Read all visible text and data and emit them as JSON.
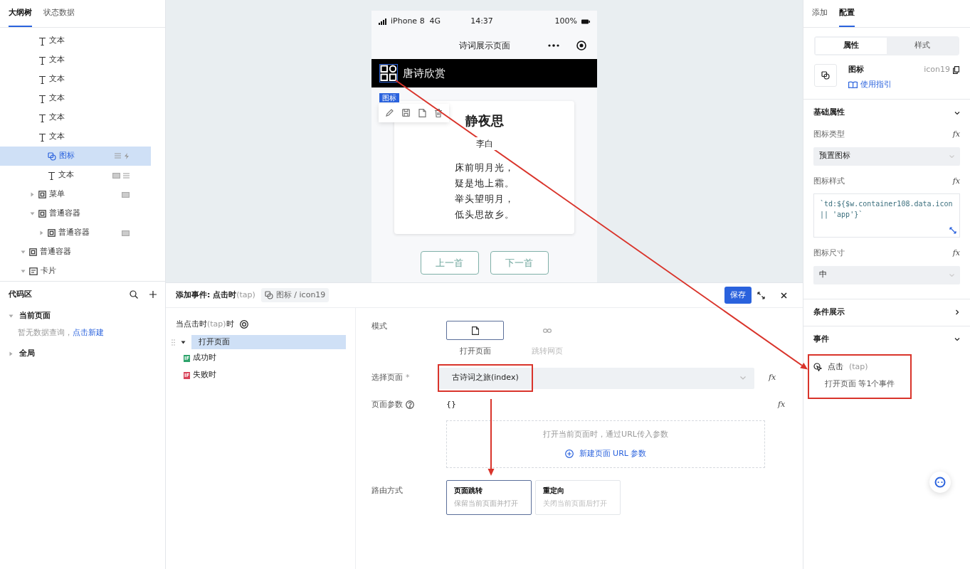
{
  "outline": {
    "tabs": [
      {
        "label": "大纲树",
        "selected": true
      },
      {
        "label": "状态数据",
        "selected": false
      }
    ],
    "nodes": [
      {
        "children": [
          {
            "label": "文本",
            "kind": "text",
            "selected": false
          },
          {
            "label": "文本",
            "kind": "text",
            "selected": false
          },
          {
            "label": "文本",
            "kind": "text",
            "selected": false
          },
          {
            "label": "文本",
            "kind": "text",
            "selected": false
          },
          {
            "label": "文本",
            "kind": "text",
            "selected": false
          },
          {
            "label": "文本",
            "kind": "text",
            "selected": false
          },
          {
            "children": [
              {
                "label": "图标",
                "kind": "icon",
                "selected": true,
                "markers": [
                  {
                    "kind": "list"
                  },
                  {
                    "kind": "event"
                  }
                ]
              },
              {
                "label": "文本",
                "kind": "text",
                "selected": false,
                "markers": [
                  {
                    "kind": "data"
                  },
                  {
                    "kind": "list"
                  }
                ]
              }
            ]
          },
          {
            "label": "菜单",
            "kind": "container",
            "expanded": false,
            "selected": false,
            "markers": [
              {
                "kind": "data"
              }
            ]
          },
          {
            "label": "普通容器",
            "kind": "container",
            "expanded": true,
            "selected": false,
            "children": [
              {
                "label": "普通容器",
                "kind": "container",
                "expanded": false,
                "selected": false,
                "markers": [
                  {
                    "kind": "data"
                  }
                ]
              }
            ]
          }
        ]
      },
      {
        "label": "普通容器",
        "kind": "container",
        "expanded": true,
        "selected": false
      },
      {
        "label": "卡片",
        "kind": "card",
        "expanded": true,
        "selected": false
      }
    ]
  },
  "code_area": {
    "title": "代码区",
    "groups": [
      {
        "label": "当前页面",
        "expanded": true,
        "empty_text": "暂无数据查询，",
        "link": "点击新建"
      },
      {
        "label": "全局",
        "expanded": false
      }
    ]
  },
  "phone": {
    "carrier": "iPhone 8  4G",
    "time": "14:37",
    "battery": "100%",
    "nav_title": "诗词展示页面",
    "header_title": "唐诗欣赏",
    "selection_tag": "图标",
    "poem": {
      "title": "静夜思",
      "author": "李白",
      "lines": [
        "床前明月光，",
        "疑是地上霜。",
        "举头望明月，",
        "低头思故乡。"
      ]
    },
    "buttons": [
      "上一首",
      "下一首"
    ]
  },
  "event_editor": {
    "title": "添加事件: 点击时",
    "title_hint": "(tap)",
    "breadcrumb": "图标 / icon19",
    "save": "保存",
    "trigger": {
      "label": "当点击时",
      "hint": "(tap)",
      "suffix": "时"
    },
    "actions": [
      {
        "label": "打开页面",
        "selected": true,
        "expanded": true,
        "branches": [
          {
            "badge": "IF",
            "label": "成功时",
            "color": "#2ea36b"
          },
          {
            "badge": "IF",
            "label": "失败时",
            "color": "#d9445a"
          }
        ]
      }
    ],
    "form": {
      "mode": {
        "label": "模式",
        "options": [
          {
            "label": "打开页面",
            "kind": "page",
            "selected": true
          },
          {
            "label": "跳转网页",
            "kind": "link",
            "selected": false
          }
        ]
      },
      "page": {
        "label": "选择页面",
        "required_mark": "*",
        "value": "古诗词之旅(index)",
        "formula": "fx",
        "highlighted": true
      },
      "params": {
        "label": "页面参数",
        "value": "{}",
        "formula": "fx",
        "hint": "打开当前页面时，通过URL传入参数",
        "add": "新建页面 URL 参数"
      },
      "route": {
        "label": "路由方式",
        "options": [
          {
            "title": "页面跳转",
            "desc": "保留当前页面并打开",
            "selected": true
          },
          {
            "title": "重定向",
            "desc": "关闭当前页面后打开",
            "selected": false
          }
        ]
      }
    }
  },
  "config": {
    "tabs": [
      {
        "label": "添加",
        "selected": false
      },
      {
        "label": "配置",
        "selected": true
      }
    ],
    "segments": [
      {
        "label": "属性",
        "selected": true
      },
      {
        "label": "样式",
        "selected": false
      }
    ],
    "component": {
      "name": "图标",
      "guide": "使用指引",
      "id": "icon19"
    },
    "sections": [
      {
        "title": "基础属性",
        "expanded": true,
        "fields": [
          {
            "label": "图标类型",
            "formula": "fx",
            "kind": "select",
            "value": "预置图标"
          },
          {
            "label": "图标样式",
            "formula": "fx",
            "kind": "code",
            "value": "`td:${$w.container108.data.icon || 'app'}`"
          },
          {
            "label": "图标尺寸",
            "formula": "fx",
            "kind": "select",
            "value": "中"
          }
        ]
      },
      {
        "title": "条件展示",
        "expanded": false
      },
      {
        "title": "事件",
        "expanded": true,
        "events": [
          {
            "name": "点击",
            "hint": "(tap)",
            "summary": "打开页面 等1个事件",
            "highlighted": true
          }
        ]
      }
    ]
  },
  "annotations": [
    {
      "kind": "arrow",
      "color": "#d9342b"
    },
    {
      "kind": "arrow",
      "color": "#d9342b"
    }
  ]
}
